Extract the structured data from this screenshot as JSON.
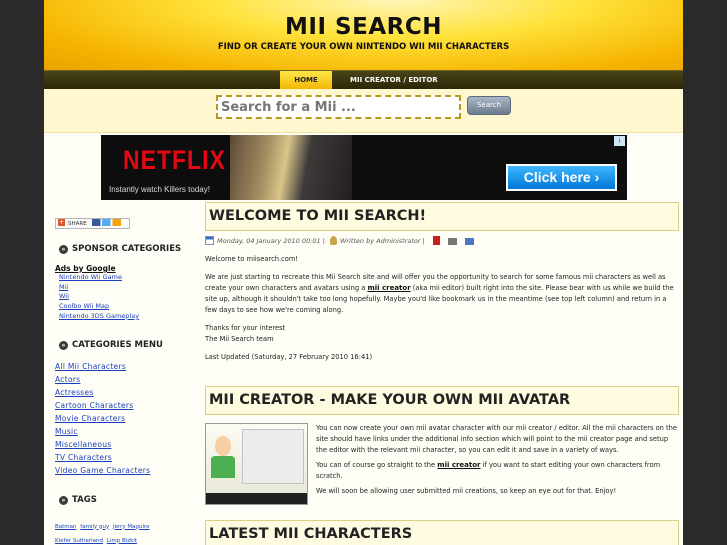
{
  "header": {
    "title": "MII SEARCH",
    "subtitle": "FIND OR CREATE YOUR OWN NINTENDO WII MII CHARACTERS"
  },
  "nav": {
    "tabs": [
      "HOME",
      "MII CREATOR / EDITOR"
    ]
  },
  "search": {
    "placeholder": "Search for a Mii ...",
    "button_label": "Search"
  },
  "ad": {
    "brand": "NETFLIX",
    "tagline": "Instantly watch Killers today!",
    "cta": "Click here ›",
    "choice_label": "i"
  },
  "sidebar": {
    "share_label": "SHARE",
    "sponsor_heading": "SPONSOR CATEGORIES",
    "ads_by_google": "Ads by Google",
    "sponsor_links": [
      "Nintendo Wii Game",
      "Mii",
      "Wii",
      "Coolbo Wii Map",
      "Nintendo 3DS Gameplay"
    ],
    "categories_heading": "CATEGORIES MENU",
    "categories": [
      "All Mii Characters",
      "Actors",
      "Actresses",
      "Cartoon Characters",
      "Movie Characters",
      "Music",
      "Miscellaneous",
      "TV Characters",
      "Video Game Characters"
    ],
    "tags_heading": "TAGS",
    "tags": [
      "Batman",
      "family guy",
      "Jerry Maguire",
      "Kiefer Sutherland",
      "Limp Bizkit"
    ]
  },
  "article": {
    "title": "WELCOME TO MII SEARCH!",
    "date": "Monday, 04 January 2010 00:01",
    "meta_separator": "|",
    "author": "Written by Administrator",
    "intro": "Welcome to miisearch.com!",
    "para_before_link": "We are just starting to recreate this Mii Search site and will offer you the opportunity to search for some famous mii characters as well as create your own characters and avatars using a ",
    "mii_creator_link": "mii creator",
    "para_after_link": " (aka mii editor) built right into the site. Please bear with us while we build the site up, although it shouldn't take too long hopefully. Maybe you'd like bookmark us in the meantime (see top left column) and return in a few days to see how we're coming along.",
    "thanks_line1": "Thanks for your interest",
    "thanks_line2": "The Mii Search team",
    "last_updated": "Last Updated (Saturday, 27 February 2010 16:41)"
  },
  "section2": {
    "title": "MII CREATOR - MAKE YOUR OWN MII AVATAR",
    "para1": "You can now create your own mii avatar character with our mii creator / editor. All the mii characters on the site should have links under the additional info section which will point to the mii creator page and setup the editor with the relevant mii character, so you can edit it and save in a variety of ways.",
    "para2_before": "You can of course go straight to the ",
    "para2_link": "mii creator",
    "para2_after": " if you want to start editing your own characters from scratch.",
    "para3": "We will soon be allowing user submitted mii creations, so keep an eye out for that. Enjoy!"
  },
  "section3": {
    "title": "LATEST MII CHARACTERS"
  }
}
